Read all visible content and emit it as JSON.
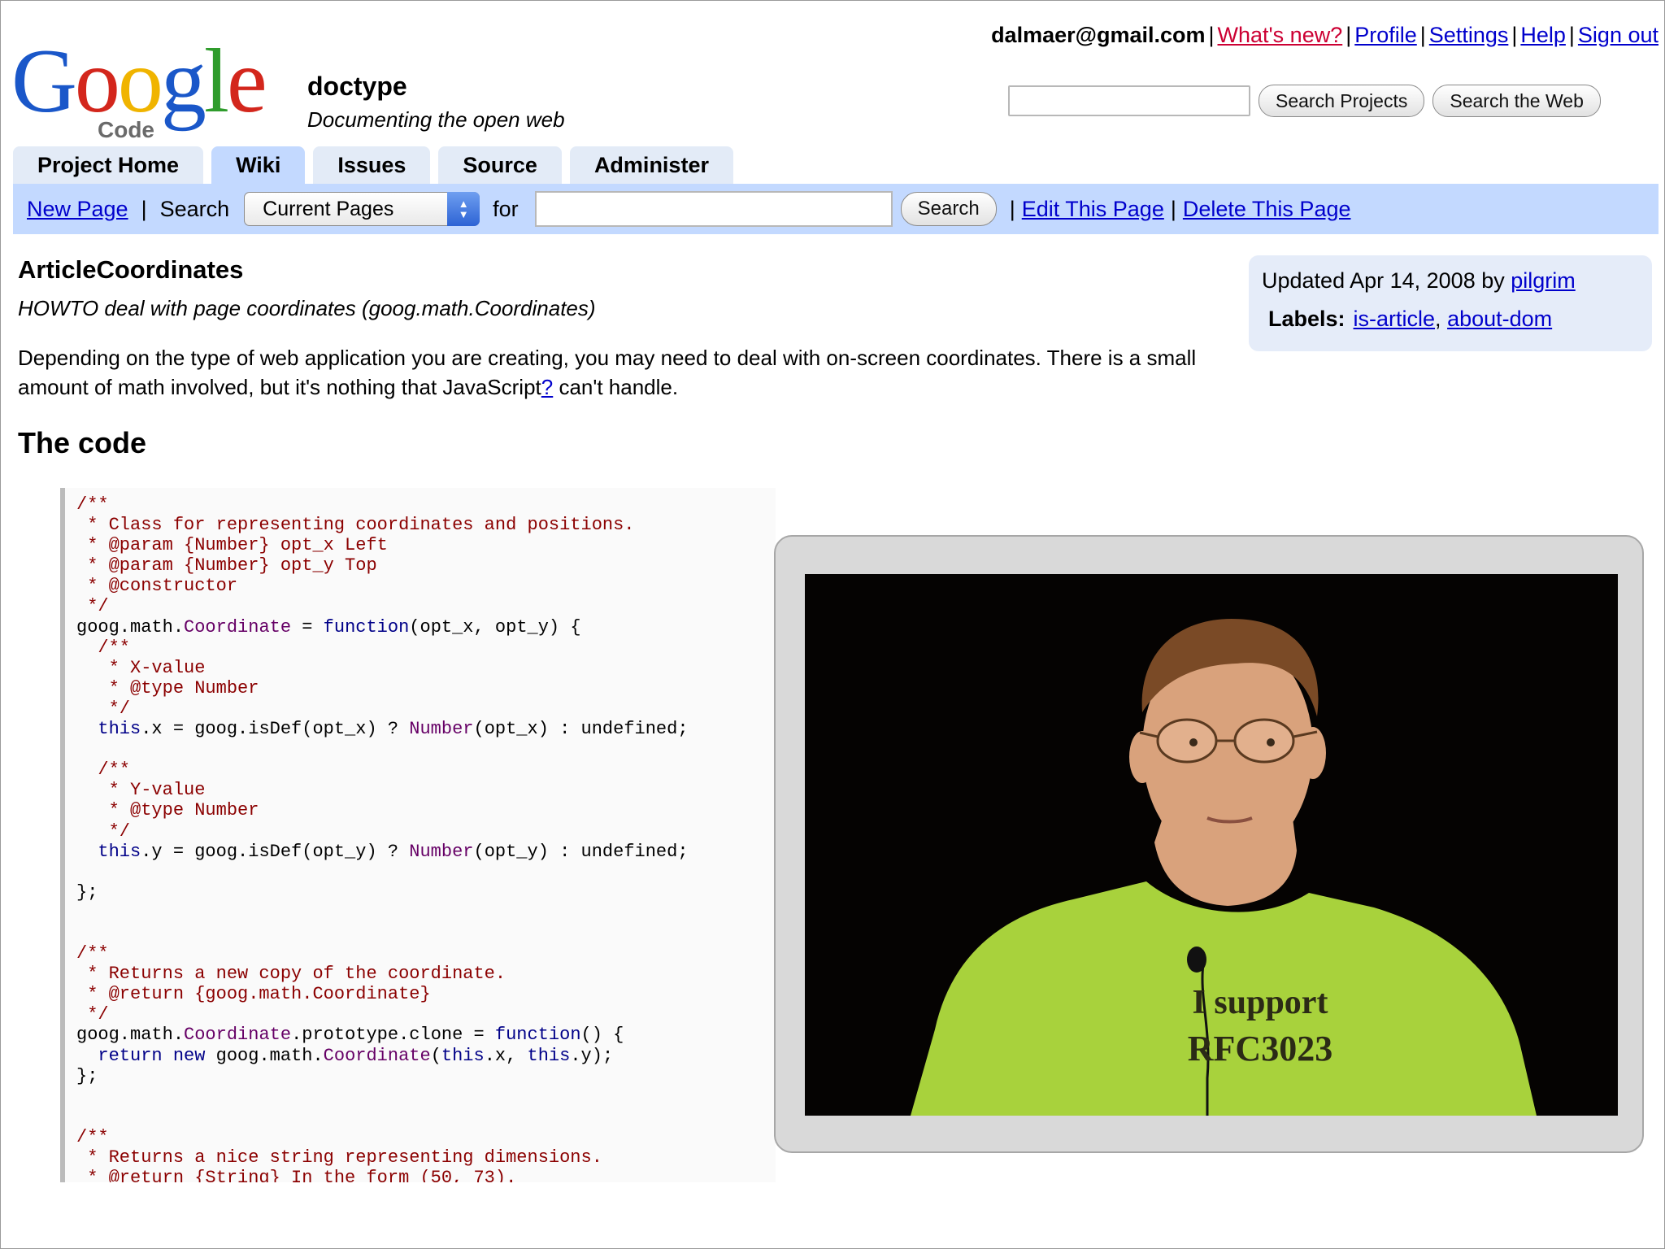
{
  "userbar": {
    "email": "dalmaer@gmail.com",
    "links": [
      "What's new?",
      "Profile",
      "Settings",
      "Help",
      "Sign out"
    ]
  },
  "logo": {
    "letters": [
      "G",
      "o",
      "o",
      "g",
      "l",
      "e"
    ],
    "sub": "Code"
  },
  "project": {
    "name": "doctype",
    "summary": "Documenting the open web"
  },
  "project_search": {
    "value": "",
    "buttons": [
      "Search Projects",
      "Search the Web"
    ]
  },
  "tabs": [
    {
      "label": "Project Home",
      "active": false
    },
    {
      "label": "Wiki",
      "active": true
    },
    {
      "label": "Issues",
      "active": false
    },
    {
      "label": "Source",
      "active": false
    },
    {
      "label": "Administer",
      "active": false
    }
  ],
  "wikibar": {
    "new_page": "New Page",
    "search_label": "Search",
    "select_value": "Current Pages",
    "for_label": "for",
    "search_button": "Search",
    "edit_link": "Edit This Page",
    "delete_link": "Delete This Page"
  },
  "article": {
    "title": "ArticleCoordinates",
    "summary": "HOWTO deal with page coordinates (goog.math.Coordinates)",
    "intro_before": "Depending on the type of web application you are creating, you may need to deal with on-screen coordinates. There is a small amount of math involved, but it's nothing that JavaScript",
    "intro_link": "?",
    "intro_after": " can't handle.",
    "heading": "The code"
  },
  "meta": {
    "updated_prefix": "Updated Apr 14, 2008 by ",
    "author": "pilgrim",
    "labels_title": "Labels:",
    "labels": [
      "is-article",
      "about-dom"
    ]
  },
  "code_lines": [
    [
      [
        "c",
        "/**"
      ]
    ],
    [
      [
        "c",
        " * Class for representing coordinates and positions."
      ]
    ],
    [
      [
        "c",
        " * @param {Number} opt_x Left"
      ]
    ],
    [
      [
        "c",
        " * @param {Number} opt_y Top"
      ]
    ],
    [
      [
        "c",
        " * @constructor"
      ]
    ],
    [
      [
        "c",
        " */"
      ]
    ],
    [
      [
        "p",
        "goog.math."
      ],
      [
        "t",
        "Coordinate"
      ],
      [
        "p",
        " = "
      ],
      [
        "k",
        "function"
      ],
      [
        "p",
        "(opt_x, opt_y) {"
      ]
    ],
    [
      [
        "c",
        "  /**"
      ]
    ],
    [
      [
        "c",
        "   * X-value"
      ]
    ],
    [
      [
        "c",
        "   * @type Number"
      ]
    ],
    [
      [
        "c",
        "   */"
      ]
    ],
    [
      [
        "k",
        "  this"
      ],
      [
        "p",
        ".x = goog.isDef(opt_x) ? "
      ],
      [
        "t",
        "Number"
      ],
      [
        "p",
        "(opt_x) : undefined;"
      ]
    ],
    [
      [
        "p",
        ""
      ]
    ],
    [
      [
        "c",
        "  /**"
      ]
    ],
    [
      [
        "c",
        "   * Y-value"
      ]
    ],
    [
      [
        "c",
        "   * @type Number"
      ]
    ],
    [
      [
        "c",
        "   */"
      ]
    ],
    [
      [
        "k",
        "  this"
      ],
      [
        "p",
        ".y = goog.isDef(opt_y) ? "
      ],
      [
        "t",
        "Number"
      ],
      [
        "p",
        "(opt_y) : undefined;"
      ]
    ],
    [
      [
        "p",
        ""
      ]
    ],
    [
      [
        "p",
        "};"
      ]
    ],
    [
      [
        "p",
        ""
      ]
    ],
    [
      [
        "p",
        ""
      ]
    ],
    [
      [
        "c",
        "/**"
      ]
    ],
    [
      [
        "c",
        " * Returns a new copy of the coordinate."
      ]
    ],
    [
      [
        "c",
        " * @return {goog.math.Coordinate}"
      ]
    ],
    [
      [
        "c",
        " */"
      ]
    ],
    [
      [
        "p",
        "goog.math."
      ],
      [
        "t",
        "Coordinate"
      ],
      [
        "p",
        ".prototype.clone = "
      ],
      [
        "k",
        "function"
      ],
      [
        "p",
        "() {"
      ]
    ],
    [
      [
        "k",
        "  return new"
      ],
      [
        "p",
        " goog.math."
      ],
      [
        "t",
        "Coordinate"
      ],
      [
        "p",
        "("
      ],
      [
        "k",
        "this"
      ],
      [
        "p",
        ".x, "
      ],
      [
        "k",
        "this"
      ],
      [
        "p",
        ".y);"
      ]
    ],
    [
      [
        "p",
        "};"
      ]
    ],
    [
      [
        "p",
        ""
      ]
    ],
    [
      [
        "p",
        ""
      ]
    ],
    [
      [
        "c",
        "/**"
      ]
    ],
    [
      [
        "c",
        " * Returns a nice string representing dimensions."
      ]
    ],
    [
      [
        "c",
        " * @return {String} In the form (50, 73)."
      ]
    ]
  ],
  "photo": {
    "shirt_line1": "I support",
    "shirt_line2": "RFC3023",
    "colors": {
      "background": "#050302",
      "shirt": "#a8d23c",
      "skin": "#d9a27c",
      "hair": "#7a4a26"
    }
  },
  "colors": {
    "tab": "#e3ebf7",
    "tab_active": "#c3d9ff",
    "link": "#0000cc",
    "comment": "#8b0000",
    "keyword": "#000088",
    "type": "#660066"
  }
}
